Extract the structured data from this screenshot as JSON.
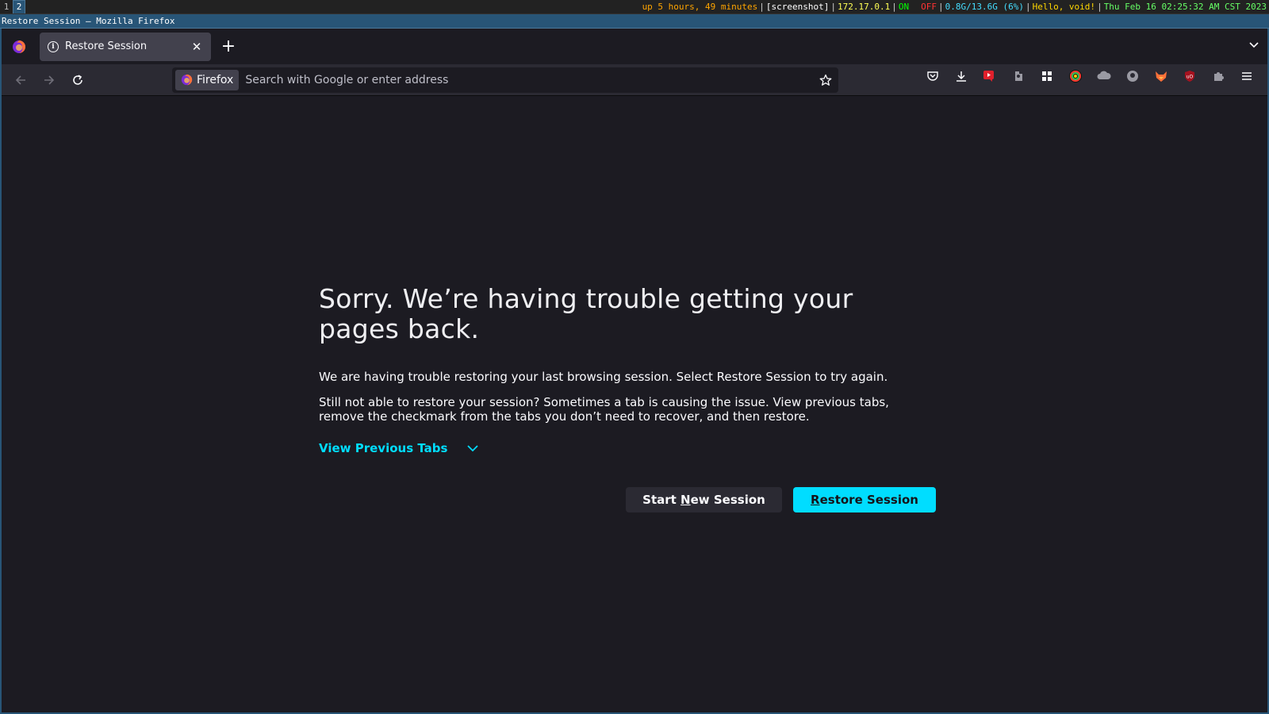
{
  "wm": {
    "workspaces": [
      "1",
      "2"
    ],
    "active_workspace": "2",
    "status": {
      "uptime": "up 5 hours, 49 minutes",
      "screenshot": "[screenshot]",
      "ip": "172.17.0.1",
      "vpn_on": "ON",
      "vpn_off": "OFF",
      "memory": "0.8G/13.6G (6%)",
      "greeting": "Hello, void!",
      "datetime": "Thu Feb 16 02:25:32 AM CST 2023"
    },
    "window_title": "Restore Session — Mozilla Firefox",
    "colors": {
      "uptime": "#ffa500",
      "screenshot": "#ffffff",
      "ip": "#ffff55",
      "on": "#00ff00",
      "off": "#ff3333",
      "memory": "#44ddff",
      "greeting": "#ffd700",
      "datetime": "#66ff66"
    }
  },
  "browser": {
    "tab": {
      "title": "Restore Session",
      "icon": "info-icon"
    },
    "urlbar": {
      "identity_label": "Firefox",
      "placeholder": "Search with Google or enter address"
    },
    "toolbar_icons": [
      "pocket-icon",
      "download-icon",
      "youtube-extension-icon",
      "extension-icon",
      "grid-extension-icon",
      "color-extension-icon",
      "cloud-extension-icon",
      "circle-extension-icon",
      "fox-extension-icon",
      "ublock-icon",
      "puzzle-icon",
      "menu-icon"
    ]
  },
  "page": {
    "heading": "Sorry. We’re having trouble getting your pages back.",
    "paragraph1": "We are having trouble restoring your last browsing session. Select Restore Session to try again.",
    "paragraph2": "Still not able to restore your session? Sometimes a tab is causing the issue. View previous tabs, remove the checkmark from the tabs you don’t need to recover, and then restore.",
    "view_previous_tabs": "View Previous Tabs",
    "start_new_prefix": "Start ",
    "start_new_access": "N",
    "start_new_suffix": "ew Session",
    "restore_access": "R",
    "restore_suffix": "estore Session",
    "accent": "#00ddff"
  }
}
